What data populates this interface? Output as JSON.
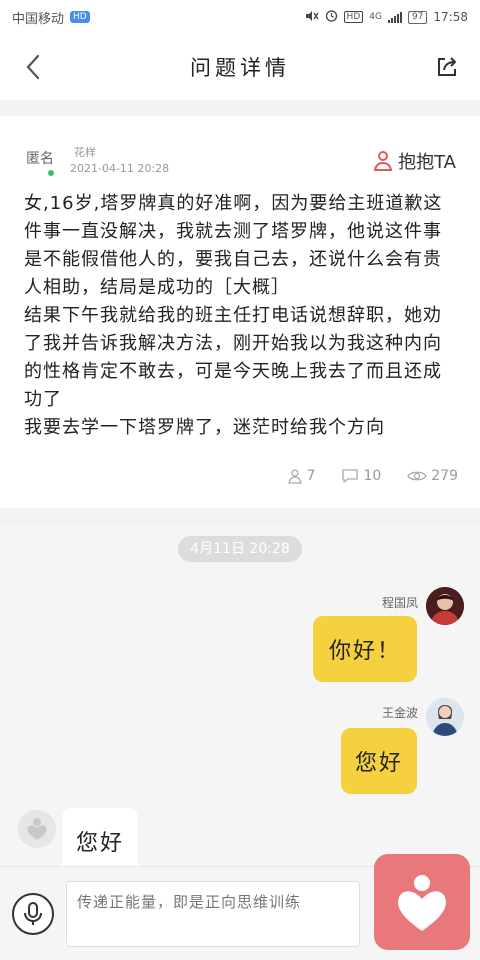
{
  "status_bar": {
    "carrier": "中国移动",
    "badge": "HD",
    "network": "4G",
    "battery": "97",
    "time": "17:58"
  },
  "header": {
    "title": "问题详情"
  },
  "question": {
    "author": "匿名",
    "author_tag": "花样",
    "date": "2021-04-11 20:28",
    "hug_label": "抱抱TA",
    "body": "女,16岁,塔罗牌真的好准啊，因为要给主班道歉这件事一直没解决，我就去测了塔罗牌，他说这件事是不能假借他人的，要我自己去，还说什么会有贵人相助，结局是成功的［大概］\n结果下午我就给我的班主任打电话说想辞职，她劝了我并告诉我解决方法，刚开始我以为我这种内向的性格肯定不敢去，可是今天晚上我去了而且还成功了\n我要去学一下塔罗牌了，迷茫时给我个方向",
    "stats": {
      "hugs": "7",
      "comments": "10",
      "views": "279"
    }
  },
  "chat": {
    "timestamp": "4月11日 20:28",
    "messages": [
      {
        "sender": "程国凤",
        "text": "你好！",
        "side": "right"
      },
      {
        "sender": "王金波",
        "text": "您好",
        "side": "right"
      },
      {
        "sender": "",
        "text": "您好",
        "side": "left"
      }
    ]
  },
  "bottom_bar": {
    "input_placeholder": "传递正能量，即是正向思维训练"
  },
  "colors": {
    "bubble_out": "#f6d13f",
    "hug_accent": "#e9787c",
    "online": "#3cc15f"
  }
}
